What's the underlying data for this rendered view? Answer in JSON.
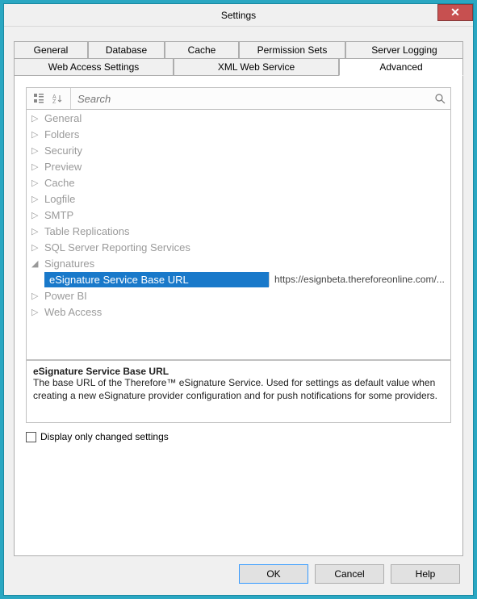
{
  "window": {
    "title": "Settings"
  },
  "tabs": {
    "row1": [
      {
        "label": "General"
      },
      {
        "label": "Database"
      },
      {
        "label": "Cache"
      },
      {
        "label": "Permission Sets"
      },
      {
        "label": "Server Logging"
      }
    ],
    "row2": [
      {
        "label": "Web Access Settings"
      },
      {
        "label": "XML Web Service"
      },
      {
        "label": "Advanced"
      }
    ]
  },
  "search": {
    "placeholder": "Search"
  },
  "tree": [
    {
      "label": "General",
      "expanded": false
    },
    {
      "label": "Folders",
      "expanded": false
    },
    {
      "label": "Security",
      "expanded": false
    },
    {
      "label": "Preview",
      "expanded": false
    },
    {
      "label": "Cache",
      "expanded": false
    },
    {
      "label": "Logfile",
      "expanded": false
    },
    {
      "label": "SMTP",
      "expanded": false
    },
    {
      "label": "Table Replications",
      "expanded": false
    },
    {
      "label": "SQL Server Reporting Services",
      "expanded": false
    },
    {
      "label": "Signatures",
      "expanded": true,
      "children": [
        {
          "label": "eSignature Service Base URL",
          "value": "https://esignbeta.thereforeonline.com/..."
        }
      ]
    },
    {
      "label": "Power BI",
      "expanded": false
    },
    {
      "label": "Web Access",
      "expanded": false
    }
  ],
  "description": {
    "title": "eSignature Service Base URL",
    "text": "The base URL of the Therefore™ eSignature Service. Used for settings as default value when creating a new eSignature provider configuration and for push notifications for some providers."
  },
  "checkbox": {
    "label": "Display only changed settings",
    "checked": false
  },
  "buttons": {
    "ok": "OK",
    "cancel": "Cancel",
    "help": "Help"
  }
}
